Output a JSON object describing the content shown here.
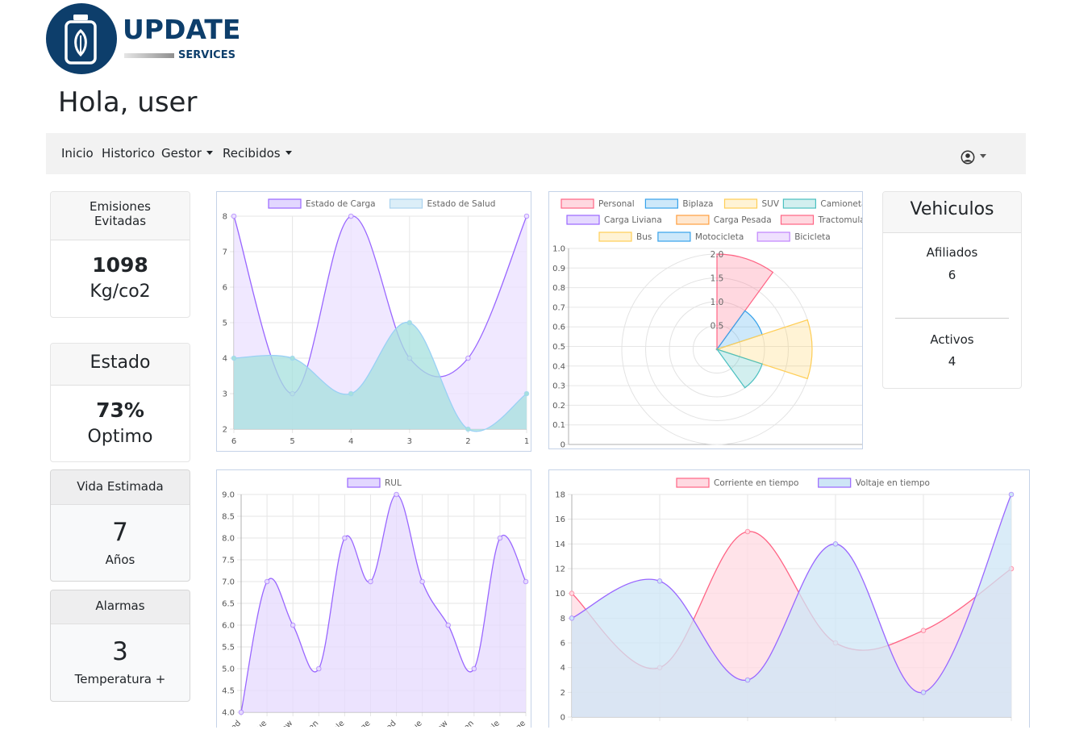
{
  "brand": {
    "name": "UPDATE",
    "sub": "SERVICES"
  },
  "greeting": "Hola, user",
  "nav": {
    "items": [
      {
        "label": "Inicio"
      },
      {
        "label": "Historico"
      },
      {
        "label": "Gestor",
        "dropdown": true
      },
      {
        "label": "Recibidos",
        "dropdown": true
      }
    ],
    "user_icon": "user-circle-icon"
  },
  "cards": {
    "emisiones": {
      "title": "Emisiones Evitadas",
      "value": "1098",
      "unit": "Kg/co2"
    },
    "estado": {
      "title": "Estado",
      "value": "73%",
      "label": "Optimo"
    },
    "vida": {
      "title": "Vida Estimada",
      "value": "7",
      "unit": "Años"
    },
    "alarmas": {
      "title": "Alarmas",
      "value": "3",
      "label": "Temperatura +"
    },
    "vehiculos": {
      "title": "Vehiculos",
      "afiliados_label": "Afiliados",
      "afiliados_value": "6",
      "activos_label": "Activos",
      "activos_value": "4"
    }
  },
  "chart_data": [
    {
      "type": "area",
      "title": "",
      "x": [
        "6",
        "5",
        "4",
        "3",
        "2",
        "1"
      ],
      "ylim": [
        2,
        8
      ],
      "yticks": [
        "8",
        "7",
        "6",
        "5",
        "4",
        "3",
        "2"
      ],
      "series": [
        {
          "name": "Estado de Carga",
          "values": [
            8,
            3,
            8,
            4,
            4,
            8
          ],
          "color": "#9966ff",
          "fill": "#ebe0ff"
        },
        {
          "name": "Estado de Salud",
          "values": [
            4,
            4,
            3,
            5,
            2,
            3
          ],
          "color": "#9ad0f5",
          "fill": "#a6e0de"
        }
      ],
      "legend": "top"
    },
    {
      "type": "polar-area",
      "title": "",
      "categories": [
        "Personal",
        "Biplaza",
        "SUV",
        "Camioneta",
        "Carga Liviana",
        "Carga Pesada",
        "Tractomula",
        "Bus",
        "Motocicleta",
        "Bicicleta"
      ],
      "values": [
        2,
        1,
        2,
        1,
        0,
        0,
        0,
        0,
        0,
        0
      ],
      "colors": [
        "#ff6384",
        "#36a2eb",
        "#ffce56",
        "#4bc0c0",
        "#9966ff",
        "#ff9f40",
        "#ff6384",
        "#ffce56",
        "#36a2eb",
        "#c084fc"
      ],
      "rticks": [
        "2.0",
        "1.5",
        "1.0",
        "0.5"
      ],
      "yticks": [
        "1.0",
        "0.9",
        "0.8",
        "0.7",
        "0.6",
        "0.5",
        "0.4",
        "0.3",
        "0.2",
        "0.1",
        "0"
      ],
      "legend": "top"
    },
    {
      "type": "area",
      "title": "",
      "categories": [
        "Red",
        "Blue",
        "Yellow",
        "Green",
        "Purple",
        "Orange",
        "Red",
        "Blue",
        "Yellow",
        "Green",
        "Purple",
        "Orange"
      ],
      "ylim": [
        4,
        9
      ],
      "yticks": [
        "9.0",
        "8.5",
        "8.0",
        "7.5",
        "7.0",
        "6.5",
        "6.0",
        "5.5",
        "5.0",
        "4.5",
        "4.0"
      ],
      "series": [
        {
          "name": "RUL",
          "values": [
            4,
            7,
            6,
            5,
            8,
            7,
            9,
            7,
            6,
            5,
            8,
            7
          ],
          "color": "#9966ff",
          "fill": "#e5d9fd"
        }
      ],
      "legend": "top"
    },
    {
      "type": "area",
      "title": "",
      "x": [
        "",
        "",
        "",
        "",
        "",
        ""
      ],
      "ylim": [
        0,
        18
      ],
      "yticks": [
        "18",
        "16",
        "14",
        "12",
        "10",
        "8",
        "6",
        "4",
        "2",
        "0"
      ],
      "series": [
        {
          "name": "Corriente en tiempo",
          "values": [
            10,
            4,
            15,
            6,
            7,
            12
          ],
          "color": "#ff6384",
          "fill": "#ffd9e1"
        },
        {
          "name": "Voltaje en tiempo",
          "values": [
            8,
            11,
            3,
            14,
            2,
            18
          ],
          "color": "#9966ff",
          "fill": "#cde6f6"
        }
      ],
      "legend": "top"
    }
  ]
}
